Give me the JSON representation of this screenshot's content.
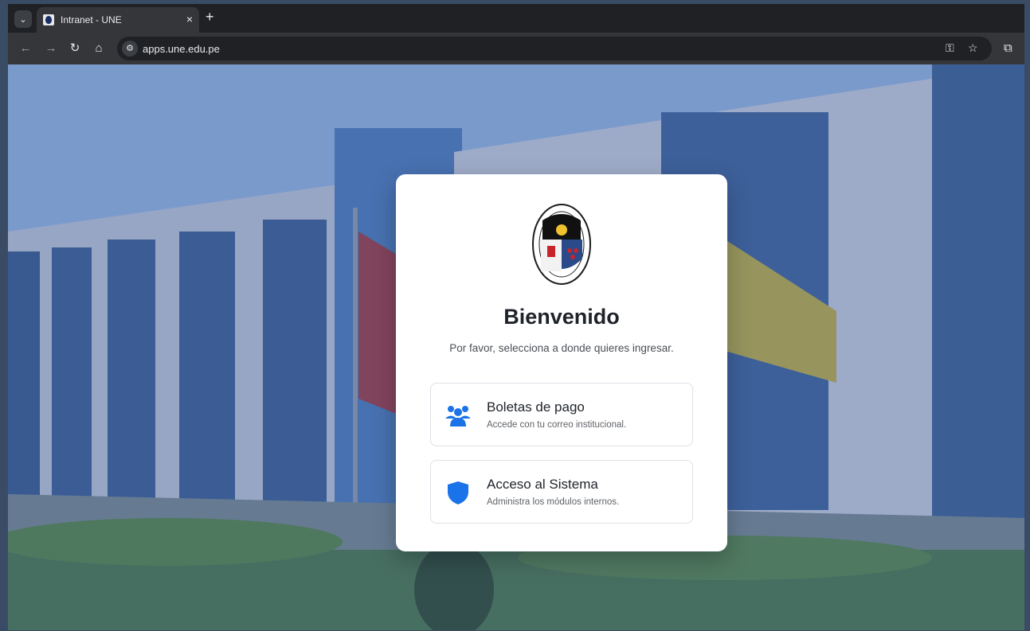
{
  "browser": {
    "tab_title": "Intranet - UNE",
    "tab_close": "×",
    "new_tab": "+",
    "tab_search": "⌄",
    "url": "apps.une.edu.pe",
    "icons": [
      "back-icon",
      "forward-icon",
      "reload-icon",
      "home-icon",
      "site-info-icon",
      "password-key-icon",
      "bookmark-star-icon",
      "extensions-icon"
    ]
  },
  "login": {
    "title": "Bienvenido",
    "subtitle": "Por favor, selecciona a donde quieres ingresar.",
    "options": [
      {
        "label": "Boletas de pago",
        "description": "Accede con tu correo institucional.",
        "icon": "users-icon"
      },
      {
        "label": "Acceso al Sistema",
        "description": "Administra los módulos internos.",
        "icon": "shield-icon"
      }
    ]
  },
  "colors": {
    "accent_blue": "#1a73e8",
    "card_bg": "#ffffff",
    "overlay": "#3a59a0"
  }
}
